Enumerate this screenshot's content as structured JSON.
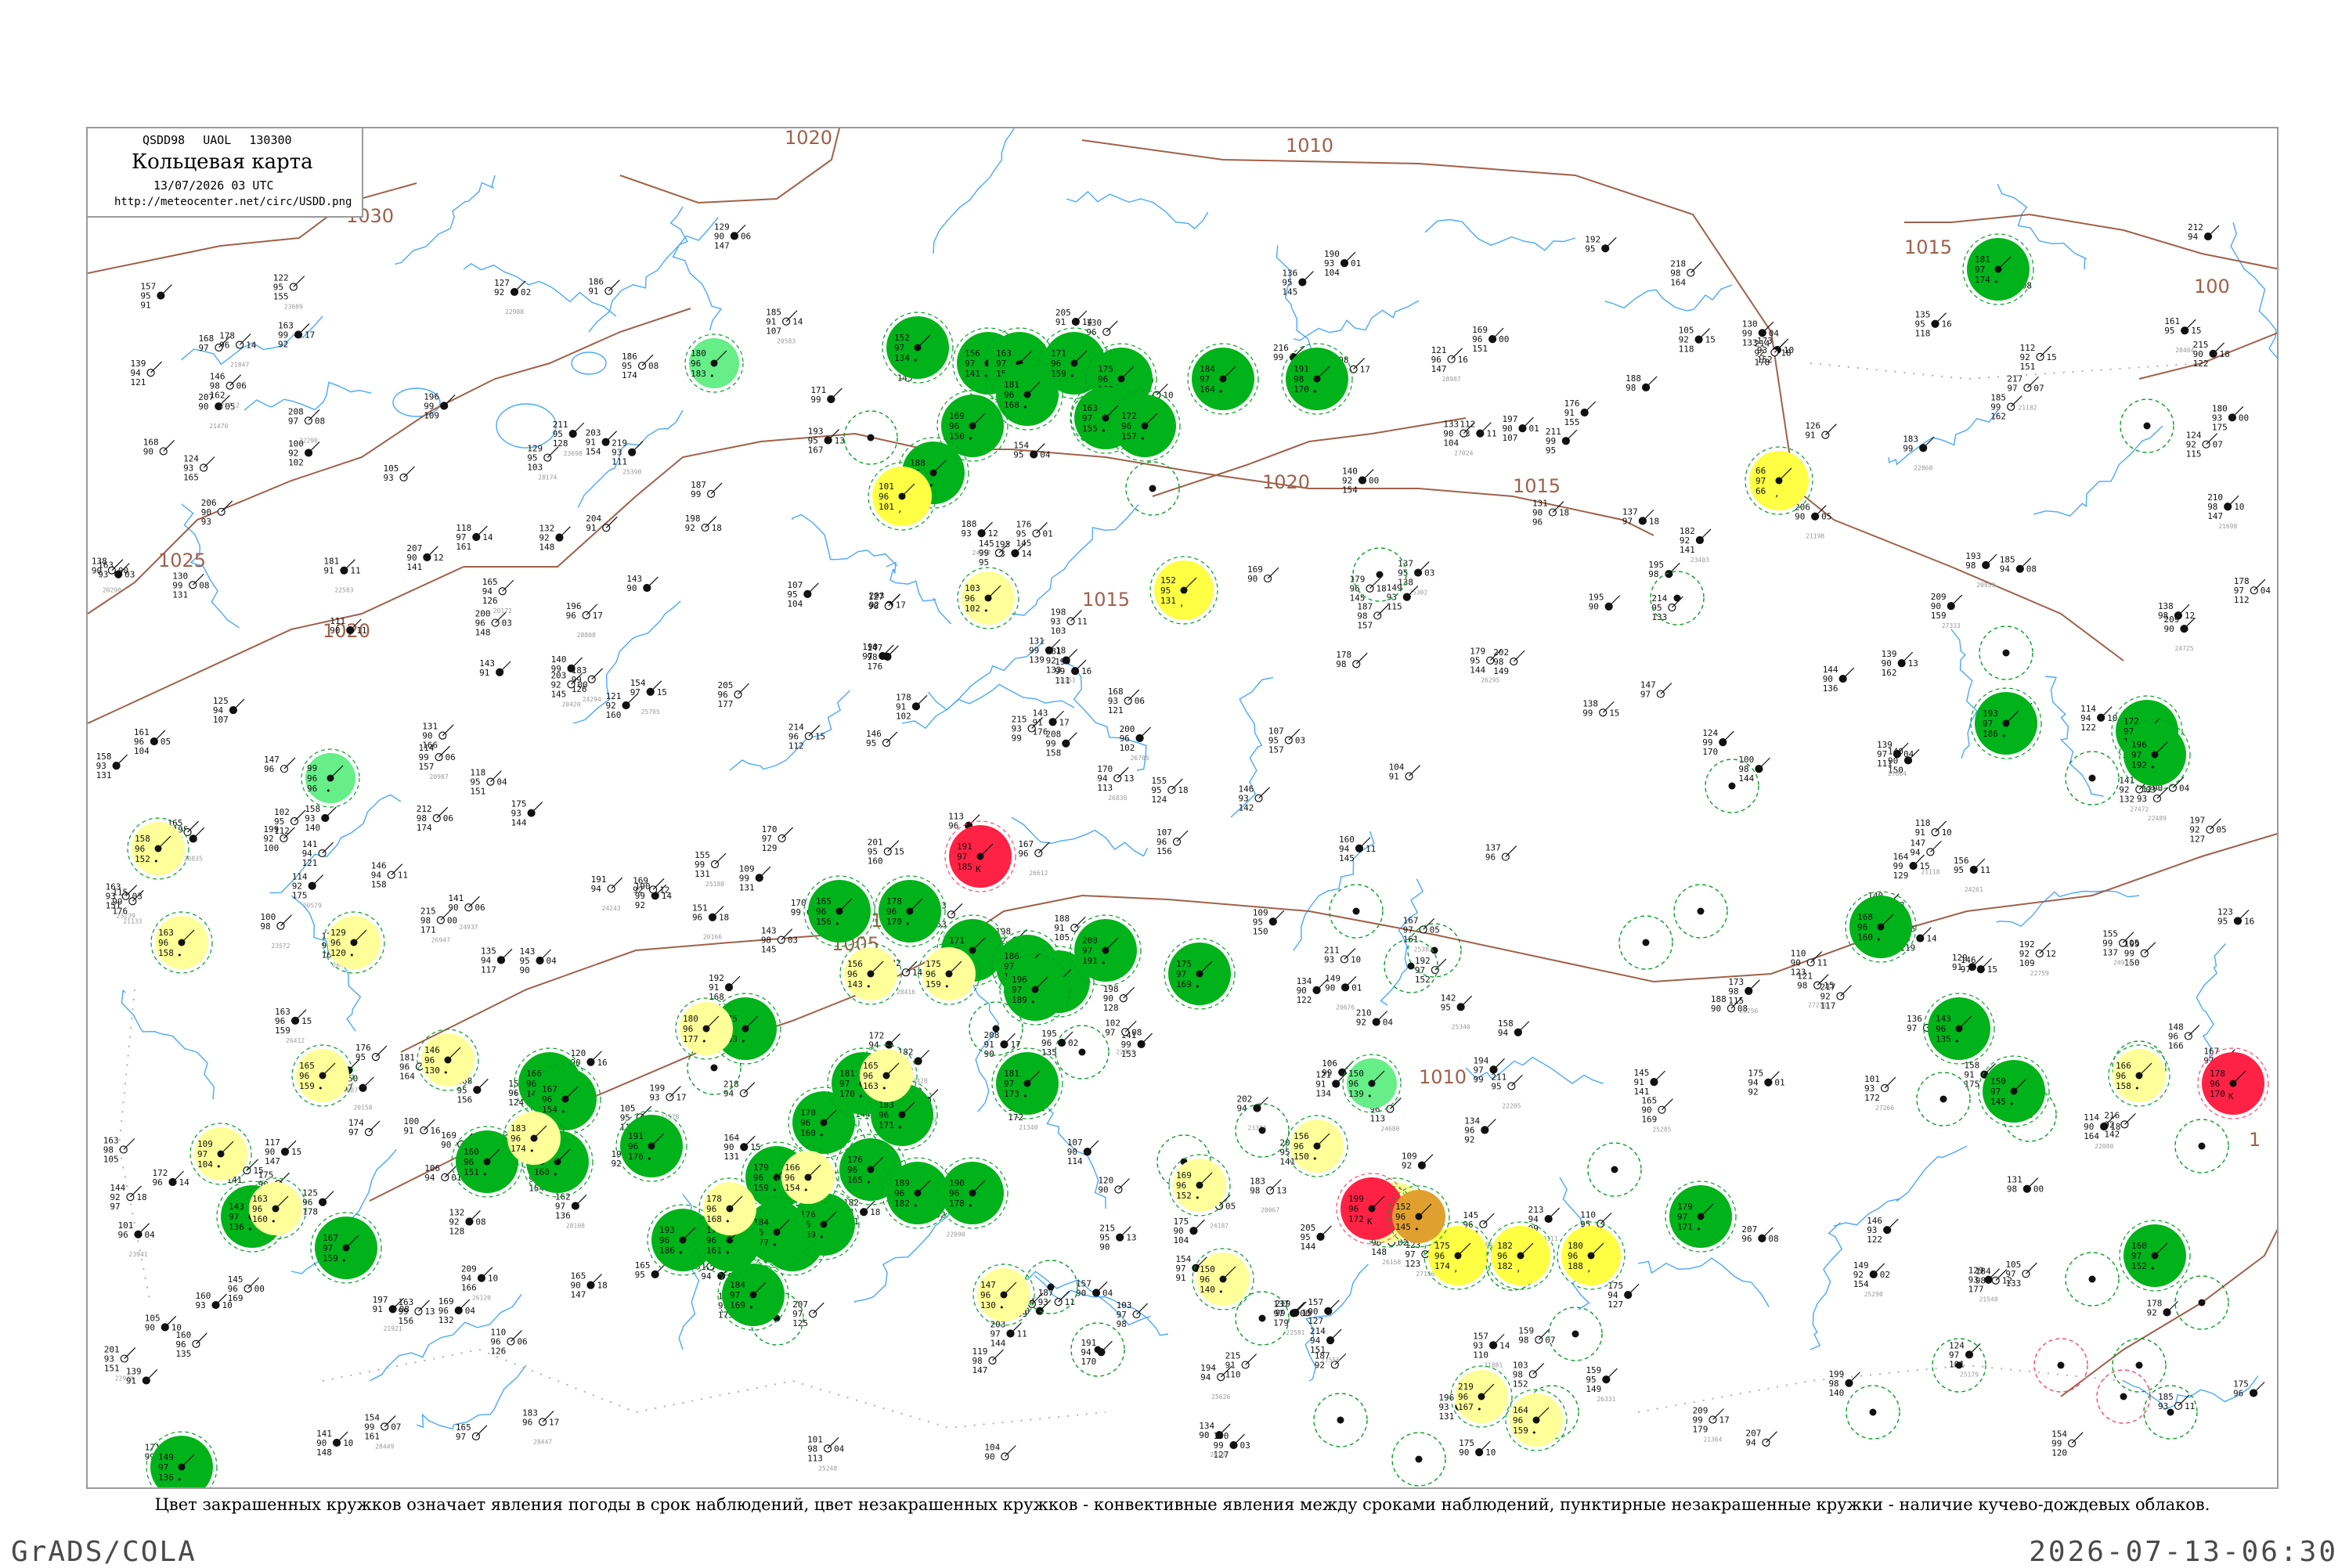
{
  "header": {
    "code": "QSDD98 UAOL 130300",
    "title": "Кольцевая карта",
    "datetime": "13/07/2026 03 UTC",
    "url": "http://meteocenter.net/circ/USDD.png"
  },
  "caption": "Цвет закрашенных кружков означает явления погоды в срок наблюдений, цвет незакрашенных кружков - конвективные явления между сроками наблюдений, пунктирные незакрашенные кружки - наличие кучево-дождевых облаков.",
  "footer": {
    "software": "GrADS/COLA",
    "timestamp": "2026-07-13-06:30"
  },
  "colors": {
    "isobar": "#a0604a",
    "river": "#4aa8ff",
    "rain": "#00b31a",
    "drizzle_mist": "#ffff44",
    "light_rain": "#ffff99",
    "thunderstorm": "#ff2244",
    "fog_haze": "#e0a030",
    "shower_light_green": "#66ee88",
    "cb_ring": "#00a020",
    "thunder_ring": "#ff4466"
  },
  "isobars": [
    {
      "label": "1020"
    },
    {
      "label": "1030"
    },
    {
      "label": "1025"
    },
    {
      "label": "1020"
    },
    {
      "label": "1015"
    },
    {
      "label": "1015"
    },
    {
      "label": "1010"
    },
    {
      "label": "1015"
    },
    {
      "label": "1005"
    },
    {
      "label": "1005"
    },
    {
      "label": "1010"
    },
    {
      "label": "1020"
    },
    {
      "label": "100"
    },
    {
      "label": "1"
    }
  ],
  "legend_symbols": [
    {
      "type": "rain",
      "icon": "filled-green-circle"
    },
    {
      "type": "drizzle_mist",
      "icon": "filled-yellow-circle"
    },
    {
      "type": "thunderstorm",
      "icon": "filled-red-circle"
    },
    {
      "type": "fog_haze",
      "icon": "filled-orange-circle"
    },
    {
      "type": "cb_clouds",
      "icon": "dashed-green-ring"
    }
  ],
  "stations": [
    {
      "kind": "rain",
      "t": "152",
      "p": "97",
      "d": "134"
    },
    {
      "kind": "rain",
      "t": "156",
      "p": "97",
      "d": "141"
    },
    {
      "kind": "rain",
      "t": "163",
      "p": "97",
      "d": "150"
    },
    {
      "kind": "rain",
      "t": "171",
      "p": "96",
      "d": "159"
    },
    {
      "kind": "rain",
      "t": "175",
      "p": "96",
      "d": "160"
    },
    {
      "kind": "rain",
      "t": "181",
      "p": "96",
      "d": "168"
    },
    {
      "kind": "rain",
      "t": "163",
      "p": "97",
      "d": "155"
    },
    {
      "kind": "rain",
      "t": "169",
      "p": "96",
      "d": "150"
    },
    {
      "kind": "rain",
      "t": "172",
      "p": "96",
      "d": "157"
    },
    {
      "kind": "rain",
      "t": "184",
      "p": "97",
      "d": "164"
    },
    {
      "kind": "rain",
      "t": "191",
      "p": "98",
      "d": "170"
    },
    {
      "kind": "rain",
      "t": "188",
      "p": "96",
      "d": "181"
    },
    {
      "kind": "rain",
      "t": "166",
      "p": "96",
      "d": "144"
    },
    {
      "kind": "rain",
      "t": "179",
      "p": "96",
      "d": "159"
    },
    {
      "kind": "rain",
      "t": "184",
      "p": "97",
      "d": "169"
    },
    {
      "kind": "rain",
      "t": "167",
      "p": "96",
      "d": "154"
    },
    {
      "kind": "rain",
      "t": "174",
      "p": "96",
      "d": "160"
    },
    {
      "kind": "rain",
      "t": "160",
      "p": "96",
      "d": "151"
    },
    {
      "kind": "rain",
      "t": "191",
      "p": "96",
      "d": "176"
    },
    {
      "kind": "rain",
      "t": "186",
      "p": "96",
      "d": "173"
    },
    {
      "kind": "rain",
      "t": "170",
      "p": "96",
      "d": "160"
    },
    {
      "kind": "rain",
      "t": "176",
      "p": "96",
      "d": "165"
    },
    {
      "kind": "rain",
      "t": "175",
      "p": "97",
      "d": "163"
    },
    {
      "kind": "rain",
      "t": "181",
      "p": "97",
      "d": "170"
    },
    {
      "kind": "rain",
      "t": "183",
      "p": "96",
      "d": "171"
    },
    {
      "kind": "rain",
      "t": "189",
      "p": "96",
      "d": "182"
    },
    {
      "kind": "rain",
      "t": "190",
      "p": "96",
      "d": "178"
    },
    {
      "kind": "rain",
      "t": "176",
      "p": "96",
      "d": "169"
    },
    {
      "kind": "rain",
      "t": "193",
      "p": "96",
      "d": "186"
    },
    {
      "kind": "rain",
      "t": "184",
      "p": "96",
      "d": "177"
    },
    {
      "kind": "rain",
      "t": "170",
      "p": "96",
      "d": "161"
    },
    {
      "kind": "rain",
      "t": "181",
      "p": "97",
      "d": "173"
    },
    {
      "kind": "rain",
      "t": "165",
      "p": "96",
      "d": "156"
    },
    {
      "kind": "rain",
      "t": "178",
      "p": "96",
      "d": "170"
    },
    {
      "kind": "rain",
      "t": "171",
      "p": "97",
      "d": "160"
    },
    {
      "kind": "rain",
      "t": "186",
      "p": "97",
      "d": "175"
    },
    {
      "kind": "rain",
      "t": "158",
      "p": "97",
      "d": "151"
    },
    {
      "kind": "rain",
      "t": "196",
      "p": "97",
      "d": "189"
    },
    {
      "kind": "rain",
      "t": "200",
      "p": "97",
      "d": "191"
    },
    {
      "kind": "rain",
      "t": "175",
      "p": "97",
      "d": "169"
    },
    {
      "kind": "rain",
      "t": "168",
      "p": "96",
      "d": "160"
    },
    {
      "kind": "rain",
      "t": "143",
      "p": "96",
      "d": "135"
    },
    {
      "kind": "rain",
      "t": "150",
      "p": "97",
      "d": "145"
    },
    {
      "kind": "rain",
      "t": "160",
      "p": "97",
      "d": "152"
    },
    {
      "kind": "rain",
      "t": "193",
      "p": "97",
      "d": "186"
    },
    {
      "kind": "rain",
      "t": "172",
      "p": "97",
      "d": "163"
    },
    {
      "kind": "rain",
      "t": "196",
      "p": "97",
      "d": "192"
    },
    {
      "kind": "rain",
      "t": "181",
      "p": "97",
      "d": "174"
    },
    {
      "kind": "rain",
      "t": "143",
      "p": "97",
      "d": "136"
    },
    {
      "kind": "rain",
      "t": "167",
      "p": "97",
      "d": "159"
    },
    {
      "kind": "rain",
      "t": "179",
      "p": "97",
      "d": "171"
    },
    {
      "kind": "rain",
      "t": "149",
      "p": "97",
      "d": "136"
    },
    {
      "kind": "drizzle",
      "t": "101",
      "p": "96",
      "d": "101"
    },
    {
      "kind": "drizzle",
      "t": "152",
      "p": "95",
      "d": "131"
    },
    {
      "kind": "drizzle",
      "t": "66",
      "p": "97",
      "d": "66"
    },
    {
      "kind": "drizzle",
      "t": "175",
      "p": "96",
      "d": "174"
    },
    {
      "kind": "drizzle",
      "t": "182",
      "p": "96",
      "d": "182"
    },
    {
      "kind": "drizzle",
      "t": "180",
      "p": "96",
      "d": "188"
    },
    {
      "kind": "light_rain",
      "t": "103",
      "p": "96",
      "d": "102"
    },
    {
      "kind": "light_rain",
      "t": "158",
      "p": "96",
      "d": "152"
    },
    {
      "kind": "light_rain",
      "t": "163",
      "p": "96",
      "d": "158"
    },
    {
      "kind": "light_rain",
      "t": "129",
      "p": "96",
      "d": "120"
    },
    {
      "kind": "light_rain",
      "t": "180",
      "p": "96",
      "d": "177"
    },
    {
      "kind": "light_rain",
      "t": "165",
      "p": "96",
      "d": "163"
    },
    {
      "kind": "light_rain",
      "t": "166",
      "p": "96",
      "d": "158"
    },
    {
      "kind": "light_rain",
      "t": "163",
      "p": "96",
      "d": "160"
    },
    {
      "kind": "light_rain",
      "t": "156",
      "p": "96",
      "d": "143"
    },
    {
      "kind": "light_rain",
      "t": "109",
      "p": "97",
      "d": "104"
    },
    {
      "kind": "light_rain",
      "t": "165",
      "p": "96",
      "d": "159"
    },
    {
      "kind": "light_rain",
      "t": "175",
      "p": "96",
      "d": "159"
    },
    {
      "kind": "light_rain",
      "t": "169",
      "p": "96",
      "d": "152"
    },
    {
      "kind": "light_rain",
      "t": "150",
      "p": "96",
      "d": "140"
    },
    {
      "kind": "light_rain",
      "t": "183",
      "p": "96",
      "d": "174"
    },
    {
      "kind": "light_rain",
      "t": "146",
      "p": "96",
      "d": "130"
    },
    {
      "kind": "light_rain",
      "t": "156",
      "p": "96",
      "d": "150"
    },
    {
      "kind": "light_rain",
      "t": "178",
      "p": "96",
      "d": "168"
    },
    {
      "kind": "light_rain",
      "t": "166",
      "p": "96",
      "d": "154"
    },
    {
      "kind": "light_rain",
      "t": "191",
      "p": "96",
      "d": "183"
    },
    {
      "kind": "light_rain",
      "t": "147",
      "p": "96",
      "d": "130"
    },
    {
      "kind": "light_rain",
      "t": "214",
      "p": "96",
      "d": "186"
    },
    {
      "kind": "light_rain",
      "t": "219",
      "p": "96",
      "d": "167"
    },
    {
      "kind": "light_rain",
      "t": "164",
      "p": "96",
      "d": "159"
    },
    {
      "kind": "thunder",
      "t": "178",
      "p": "96",
      "d": "170"
    },
    {
      "kind": "thunder",
      "t": "191",
      "p": "97",
      "d": "185"
    },
    {
      "kind": "thunder",
      "t": "199",
      "p": "96",
      "d": "172"
    },
    {
      "kind": "haze",
      "t": "152",
      "p": "96",
      "d": "145"
    },
    {
      "kind": "shower",
      "t": "99",
      "p": "96",
      "d": "96"
    },
    {
      "kind": "shower",
      "t": "180",
      "p": "96",
      "d": "183"
    },
    {
      "kind": "shower",
      "t": "150",
      "p": "96",
      "d": "139"
    }
  ]
}
